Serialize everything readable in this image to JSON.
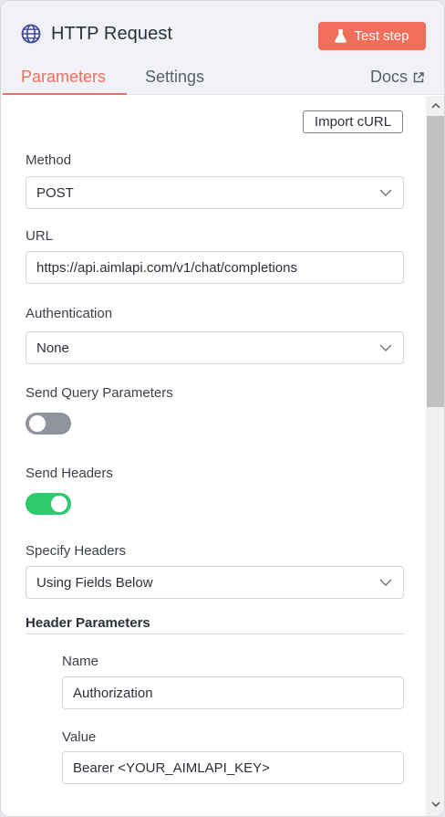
{
  "header": {
    "title": "HTTP Request",
    "test_button_label": "Test step",
    "icon": "globe-icon",
    "tabs": [
      {
        "label": "Parameters",
        "active": true
      },
      {
        "label": "Settings",
        "active": false
      }
    ],
    "docs_label": "Docs",
    "accent_color": "#f26e5b"
  },
  "params": {
    "import_curl_label": "Import cURL",
    "method": {
      "label": "Method",
      "value": "POST"
    },
    "url": {
      "label": "URL",
      "value": "https://api.aimlapi.com/v1/chat/completions"
    },
    "authentication": {
      "label": "Authentication",
      "value": "None"
    },
    "send_query": {
      "label": "Send Query Parameters",
      "enabled": false
    },
    "send_headers": {
      "label": "Send Headers",
      "enabled": true
    },
    "specify_headers": {
      "label": "Specify Headers",
      "value": "Using Fields Below"
    },
    "header_parameters": {
      "title": "Header Parameters",
      "name_label": "Name",
      "name_value": "Authorization",
      "value_label": "Value",
      "value_value": "Bearer <YOUR_AIMLAPI_KEY>"
    }
  },
  "colors": {
    "toggle_on": "#2ccb6d",
    "toggle_off": "#8f939b"
  }
}
